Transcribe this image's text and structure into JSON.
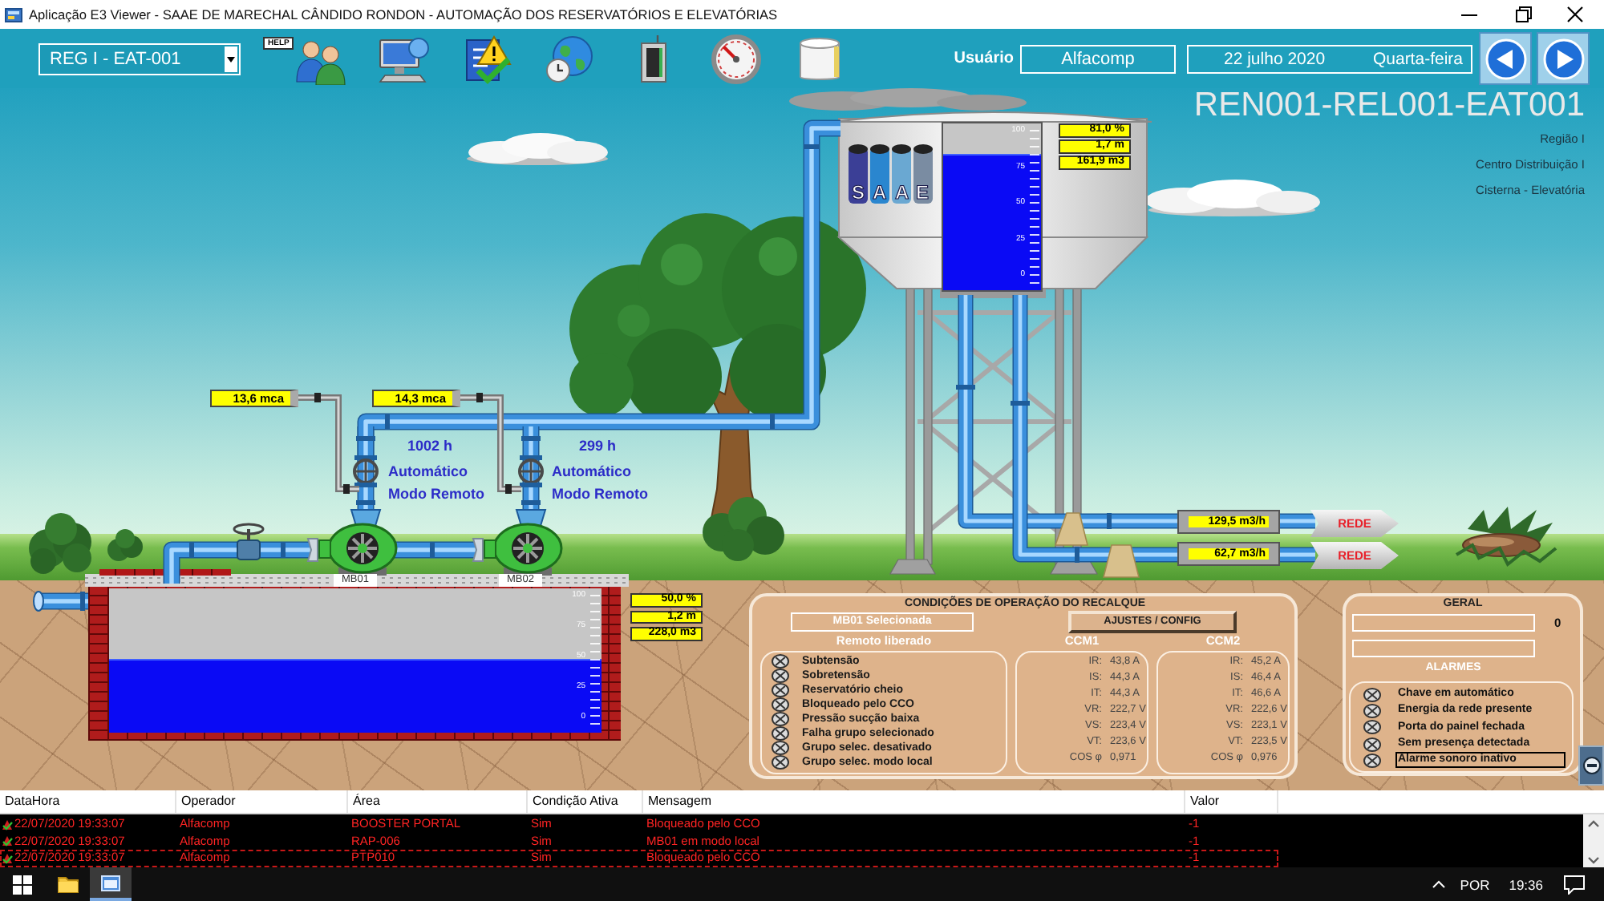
{
  "window": {
    "title": "Aplicação E3 Viewer - SAAE DE MARECHAL CÂNDIDO RONDON - AUTOMAÇÃO DOS RESERVATÓRIOS E ELEVATÓRIAS"
  },
  "toolbar": {
    "station": "REG I - EAT-001",
    "help_tag": "HELP",
    "user_label": "Usuário",
    "user": "Alfacomp",
    "date": "22 julho 2020",
    "weekday": "Quarta-feira"
  },
  "header": {
    "code": "REN001-REL001-EAT001",
    "lines": [
      "Região I",
      "Centro Distribuição I",
      "Cisterna - Elevatória"
    ]
  },
  "elevated_tank": {
    "logo_letters": [
      "S",
      "A",
      "A",
      "E"
    ],
    "level": 0.81,
    "scale": [
      "100",
      "75",
      "50",
      "25",
      "0"
    ],
    "readouts": [
      "81,0 %",
      "1,7 m",
      "161,9 m3"
    ]
  },
  "pumps": [
    {
      "label": "MB01",
      "pressure": "13,6 mca",
      "hours": "1002 h",
      "mode": "Automático",
      "control": "Modo Remoto"
    },
    {
      "label": "MB02",
      "pressure": "14,3 mca",
      "hours": "299 h",
      "mode": "Automático",
      "control": "Modo Remoto"
    }
  ],
  "outlets": [
    {
      "flow": "129,5 m3/h",
      "destination": "REDE"
    },
    {
      "flow": "62,7 m3/h",
      "destination": "REDE"
    }
  ],
  "cistern": {
    "level": 0.5,
    "scale": [
      "100",
      "75",
      "50",
      "25",
      "0"
    ],
    "readouts": [
      "50,0 %",
      "1,2 m",
      "228,0 m3"
    ]
  },
  "operation_panel": {
    "title": "CONDIÇÕES DE OPERAÇÃO DO RECALQUE",
    "selected_pump": "MB01 Selecionada",
    "settings_button": "AJUSTES / CONFIG",
    "status_label": "Remoto liberado",
    "conditions": [
      {
        "label": "Subtensão",
        "active": false
      },
      {
        "label": "Sobretensão",
        "active": false
      },
      {
        "label": "Reservatório cheio",
        "active": false
      },
      {
        "label": "Bloqueado pelo CCO",
        "active": false
      },
      {
        "label": "Pressão sucção baixa",
        "active": false
      },
      {
        "label": "Falha grupo selecionado",
        "active": false
      },
      {
        "label": "Grupo selec. desativado",
        "active": false
      },
      {
        "label": "Grupo selec. modo local",
        "active": false
      }
    ],
    "ccms": [
      {
        "title": "CCM1",
        "readings": [
          {
            "label": "IR:",
            "value": "43,8 A"
          },
          {
            "label": "IS:",
            "value": "44,3 A"
          },
          {
            "label": "IT:",
            "value": "44,3 A"
          },
          {
            "label": "VR:",
            "value": "222,7 V"
          },
          {
            "label": "VS:",
            "value": "223,4 V"
          },
          {
            "label": "VT:",
            "value": "223,6 V"
          },
          {
            "label": "COS φ",
            "value": "0,971"
          }
        ]
      },
      {
        "title": "CCM2",
        "readings": [
          {
            "label": "IR:",
            "value": "45,2 A"
          },
          {
            "label": "IS:",
            "value": "46,4 A"
          },
          {
            "label": "IT:",
            "value": "46,6 A"
          },
          {
            "label": "VR:",
            "value": "222,6 V"
          },
          {
            "label": "VS:",
            "value": "223,1 V"
          },
          {
            "label": "VT:",
            "value": "223,5 V"
          },
          {
            "label": "COS φ",
            "value": "0,976"
          }
        ]
      }
    ]
  },
  "general_panel": {
    "title": "GERAL",
    "counter": "0",
    "alarms_title": "ALARMES",
    "alarms": [
      {
        "label": "Chave em automático",
        "active": false,
        "selected": false
      },
      {
        "label": "Energia da rede presente",
        "active": false,
        "selected": false
      },
      {
        "label": "Porta do painel fechada",
        "active": false,
        "selected": false
      },
      {
        "label": "Sem presença detectada",
        "active": false,
        "selected": false
      },
      {
        "label": "Alarme sonoro inativo",
        "active": false,
        "selected": true
      }
    ]
  },
  "event_table": {
    "columns": [
      "DataHora",
      "Operador",
      "Área",
      "Condição Ativa",
      "Mensagem",
      "Valor"
    ],
    "rows": [
      {
        "cells": [
          "22/07/2020 19:33:07",
          "Alfacomp",
          "BOOSTER PORTAL",
          "Sim",
          "Bloqueado pelo CCO",
          "-1"
        ],
        "selected": false
      },
      {
        "cells": [
          "22/07/2020 19:33:07",
          "Alfacomp",
          "RAP-006",
          "Sim",
          "MB01 em modo local",
          "-1"
        ],
        "selected": false
      },
      {
        "cells": [
          "22/07/2020 19:33:07",
          "Alfacomp",
          "PTP010",
          "Sim",
          "Bloqueado pelo CCO",
          "-1"
        ],
        "selected": true
      }
    ]
  },
  "taskbar": {
    "language": "POR",
    "time": "19:36"
  }
}
